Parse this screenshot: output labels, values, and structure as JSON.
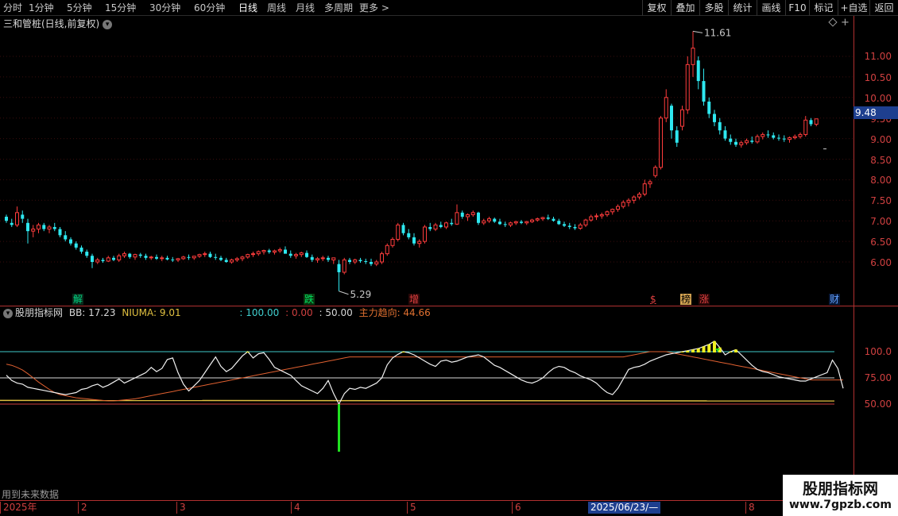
{
  "toolbar": {
    "periods": [
      "分时",
      "1分钟",
      "5分钟",
      "15分钟",
      "30分钟",
      "60分钟",
      "日线",
      "周线",
      "月线",
      "多周期",
      "更多 >"
    ],
    "active_period": "日线",
    "buttons": [
      "复权",
      "叠加",
      "多股",
      "统计",
      "画线",
      "F10",
      "标记",
      "+自选",
      "返回"
    ]
  },
  "chart_title": "三和管桩(日线,前复权)",
  "main_axis": {
    "labels": [
      "11.00",
      "10.50",
      "10.00",
      "9.50",
      "9.00",
      "8.50",
      "8.00",
      "7.50",
      "7.00",
      "6.50",
      "6.00"
    ],
    "current_price": "9.48"
  },
  "annotations": {
    "high": "11.61",
    "low": "5.29"
  },
  "events": [
    {
      "label": "解",
      "color": "#00d080",
      "bg": "#0a2a1a"
    },
    {
      "label": "跌",
      "color": "#00e060",
      "bg": "#0a3a10"
    },
    {
      "label": "增",
      "color": "#e04040",
      "bg": "#2a0808"
    },
    {
      "label": "$",
      "color": "#e04040",
      "bg": "#000000"
    },
    {
      "label": "榜",
      "color": "#000000",
      "bg": "#d0a050"
    },
    {
      "label": "涨",
      "color": "#e04040",
      "bg": "#2a0808"
    },
    {
      "label": "财",
      "color": "#60a0ff",
      "bg": "#0a1a3a"
    }
  ],
  "indicator": {
    "name": "股朋指标网",
    "bb_label": "BB: 17.23",
    "niuma_label": "NIUMA: 9.01",
    "l100": ": 100.00",
    "l0": ": 0.00",
    "l50": ": 50.00",
    "trend_label": "主力趋向: 44.66",
    "axis_labels": [
      "100.0",
      "75.00",
      "50.00"
    ]
  },
  "note": "用到未来数据",
  "dates": [
    "2025年",
    "2",
    "3",
    "4",
    "5",
    "6",
    "2025/06/23/—",
    "8"
  ],
  "watermark": {
    "line1": "股朋指标网",
    "line2": "www.7gpzb.com"
  },
  "colors": {
    "up": "#ff3c3c",
    "down": "#2ee8f0",
    "bg": "#000000"
  },
  "chart_data": {
    "type": "candlestick",
    "candles": [
      [
        7.1,
        7.15,
        6.95,
        7.0
      ],
      [
        6.95,
        7.05,
        6.85,
        6.9
      ],
      [
        6.9,
        7.35,
        6.85,
        7.2
      ],
      [
        7.15,
        7.25,
        6.95,
        7.05
      ],
      [
        6.95,
        7.05,
        6.45,
        6.75
      ],
      [
        6.75,
        6.9,
        6.6,
        6.8
      ],
      [
        6.8,
        6.95,
        6.7,
        6.9
      ],
      [
        6.9,
        6.95,
        6.75,
        6.8
      ],
      [
        6.8,
        6.9,
        6.7,
        6.85
      ],
      [
        6.85,
        6.95,
        6.75,
        6.8
      ],
      [
        6.8,
        6.85,
        6.6,
        6.65
      ],
      [
        6.65,
        6.75,
        6.5,
        6.55
      ],
      [
        6.55,
        6.6,
        6.4,
        6.45
      ],
      [
        6.45,
        6.5,
        6.3,
        6.35
      ],
      [
        6.35,
        6.4,
        6.2,
        6.25
      ],
      [
        6.25,
        6.3,
        6.1,
        6.15
      ],
      [
        6.15,
        6.2,
        5.85,
        6.0
      ],
      [
        6.0,
        6.1,
        5.95,
        6.05
      ],
      [
        6.05,
        6.1,
        5.98,
        6.02
      ],
      [
        6.02,
        6.15,
        6.0,
        6.1
      ],
      [
        6.1,
        6.15,
        6.02,
        6.05
      ],
      [
        6.05,
        6.2,
        6.0,
        6.15
      ],
      [
        6.15,
        6.25,
        6.1,
        6.2
      ],
      [
        6.2,
        6.22,
        6.08,
        6.12
      ],
      [
        6.12,
        6.2,
        6.05,
        6.18
      ],
      [
        6.18,
        6.22,
        6.1,
        6.15
      ],
      [
        6.15,
        6.2,
        6.05,
        6.1
      ],
      [
        6.1,
        6.15,
        6.05,
        6.12
      ],
      [
        6.12,
        6.18,
        6.05,
        6.08
      ],
      [
        6.08,
        6.15,
        6.02,
        6.1
      ],
      [
        6.1,
        6.15,
        6.04,
        6.06
      ],
      [
        6.06,
        6.12,
        6.0,
        6.05
      ],
      [
        6.05,
        6.1,
        6.0,
        6.08
      ],
      [
        6.08,
        6.15,
        6.05,
        6.12
      ],
      [
        6.12,
        6.18,
        6.05,
        6.1
      ],
      [
        6.1,
        6.15,
        6.05,
        6.14
      ],
      [
        6.14,
        6.2,
        6.1,
        6.18
      ],
      [
        6.18,
        6.25,
        6.12,
        6.2
      ],
      [
        6.2,
        6.25,
        6.1,
        6.12
      ],
      [
        6.12,
        6.2,
        6.05,
        6.1
      ],
      [
        6.1,
        6.15,
        6.02,
        6.05
      ],
      [
        6.05,
        6.1,
        5.98,
        6.0
      ],
      [
        6.0,
        6.08,
        5.96,
        6.05
      ],
      [
        6.05,
        6.12,
        6.0,
        6.08
      ],
      [
        6.08,
        6.15,
        6.02,
        6.12
      ],
      [
        6.12,
        6.2,
        6.08,
        6.18
      ],
      [
        6.18,
        6.25,
        6.12,
        6.2
      ],
      [
        6.2,
        6.28,
        6.15,
        6.25
      ],
      [
        6.25,
        6.3,
        6.18,
        6.28
      ],
      [
        6.28,
        6.32,
        6.2,
        6.24
      ],
      [
        6.24,
        6.3,
        6.18,
        6.27
      ],
      [
        6.27,
        6.35,
        6.22,
        6.3
      ],
      [
        6.3,
        6.38,
        6.25,
        6.2
      ],
      [
        6.2,
        6.28,
        6.1,
        6.15
      ],
      [
        6.15,
        6.22,
        6.08,
        6.18
      ],
      [
        6.18,
        6.25,
        6.12,
        6.22
      ],
      [
        6.22,
        6.28,
        6.1,
        6.12
      ],
      [
        6.12,
        6.18,
        6.0,
        6.05
      ],
      [
        6.05,
        6.12,
        5.98,
        6.08
      ],
      [
        6.08,
        6.15,
        6.02,
        6.1
      ],
      [
        6.1,
        6.15,
        6.0,
        6.05
      ],
      [
        6.05,
        6.1,
        5.95,
        6.1
      ],
      [
        5.95,
        6.05,
        5.29,
        5.75
      ],
      [
        5.75,
        6.1,
        5.7,
        6.05
      ],
      [
        6.05,
        6.1,
        5.95,
        6.0
      ],
      [
        6.0,
        6.08,
        5.95,
        6.05
      ],
      [
        6.05,
        6.1,
        5.98,
        6.02
      ],
      [
        6.02,
        6.08,
        5.95,
        6.0
      ],
      [
        6.0,
        6.08,
        5.9,
        5.95
      ],
      [
        5.95,
        6.05,
        5.9,
        6.0
      ],
      [
        6.0,
        6.25,
        5.95,
        6.2
      ],
      [
        6.2,
        6.45,
        6.15,
        6.4
      ],
      [
        6.4,
        6.6,
        6.35,
        6.55
      ],
      [
        6.55,
        6.95,
        6.5,
        6.9
      ],
      [
        6.9,
        6.95,
        6.65,
        6.7
      ],
      [
        6.7,
        6.8,
        6.55,
        6.6
      ],
      [
        6.6,
        6.7,
        6.4,
        6.45
      ],
      [
        6.45,
        6.55,
        6.35,
        6.5
      ],
      [
        6.5,
        6.9,
        6.45,
        6.85
      ],
      [
        6.85,
        6.95,
        6.75,
        6.8
      ],
      [
        6.8,
        6.95,
        6.75,
        6.9
      ],
      [
        6.9,
        6.98,
        6.82,
        6.85
      ],
      [
        6.85,
        6.98,
        6.8,
        6.95
      ],
      [
        6.95,
        7.05,
        6.88,
        6.92
      ],
      [
        6.92,
        7.4,
        6.9,
        7.2
      ],
      [
        7.2,
        7.25,
        7.05,
        7.1
      ],
      [
        7.1,
        7.18,
        7.0,
        7.15
      ],
      [
        7.15,
        7.25,
        7.1,
        7.2
      ],
      [
        7.2,
        7.22,
        6.9,
        6.95
      ],
      [
        6.95,
        7.05,
        6.9,
        7.0
      ],
      [
        7.0,
        7.1,
        6.95,
        7.05
      ],
      [
        7.05,
        7.08,
        6.95,
        6.98
      ],
      [
        6.98,
        7.05,
        6.9,
        6.92
      ],
      [
        6.92,
        6.98,
        6.85,
        6.9
      ],
      [
        6.9,
        6.98,
        6.85,
        6.95
      ],
      [
        6.95,
        7.0,
        6.9,
        6.98
      ],
      [
        6.98,
        7.02,
        6.92,
        6.95
      ],
      [
        6.95,
        7.0,
        6.9,
        6.98
      ],
      [
        6.98,
        7.05,
        6.95,
        7.02
      ],
      [
        7.02,
        7.08,
        6.98,
        7.05
      ],
      [
        7.05,
        7.1,
        7.0,
        7.08
      ],
      [
        7.08,
        7.15,
        7.02,
        7.05
      ],
      [
        7.05,
        7.1,
        6.98,
        7.0
      ],
      [
        7.0,
        7.05,
        6.9,
        6.92
      ],
      [
        6.92,
        6.98,
        6.85,
        6.88
      ],
      [
        6.88,
        6.95,
        6.8,
        6.85
      ],
      [
        6.85,
        6.92,
        6.78,
        6.82
      ],
      [
        6.82,
        6.95,
        6.78,
        6.9
      ],
      [
        6.9,
        7.05,
        6.85,
        7.02
      ],
      [
        7.02,
        7.15,
        6.98,
        7.1
      ],
      [
        7.1,
        7.18,
        7.02,
        7.12
      ],
      [
        7.12,
        7.2,
        7.05,
        7.15
      ],
      [
        7.15,
        7.25,
        7.1,
        7.22
      ],
      [
        7.22,
        7.3,
        7.15,
        7.28
      ],
      [
        7.28,
        7.4,
        7.22,
        7.35
      ],
      [
        7.35,
        7.5,
        7.3,
        7.45
      ],
      [
        7.45,
        7.55,
        7.35,
        7.5
      ],
      [
        7.5,
        7.62,
        7.42,
        7.58
      ],
      [
        7.58,
        7.7,
        7.52,
        7.65
      ],
      [
        7.65,
        8.0,
        7.6,
        7.9
      ],
      [
        7.9,
        8.0,
        7.8,
        7.95
      ],
      [
        8.1,
        8.35,
        8.05,
        8.3
      ],
      [
        8.3,
        9.55,
        8.25,
        9.5
      ],
      [
        9.5,
        10.2,
        9.4,
        10.0
      ],
      [
        9.8,
        9.85,
        9.0,
        9.2
      ],
      [
        9.2,
        9.3,
        8.8,
        8.9
      ],
      [
        9.3,
        9.8,
        9.2,
        9.7
      ],
      [
        9.7,
        11.0,
        9.6,
        10.8
      ],
      [
        10.8,
        11.61,
        10.5,
        11.2
      ],
      [
        10.9,
        11.0,
        10.2,
        10.4
      ],
      [
        10.4,
        10.7,
        9.8,
        9.9
      ],
      [
        9.9,
        10.0,
        9.5,
        9.6
      ],
      [
        9.6,
        9.7,
        9.3,
        9.4
      ],
      [
        9.4,
        9.5,
        9.1,
        9.2
      ],
      [
        9.2,
        9.3,
        8.95,
        9.0
      ],
      [
        9.0,
        9.1,
        8.85,
        8.92
      ],
      [
        8.92,
        9.0,
        8.8,
        8.85
      ],
      [
        8.85,
        8.95,
        8.78,
        8.9
      ],
      [
        8.9,
        9.0,
        8.85,
        8.95
      ],
      [
        8.95,
        9.05,
        8.88,
        8.92
      ],
      [
        8.92,
        9.1,
        8.88,
        9.05
      ],
      [
        9.05,
        9.15,
        8.98,
        9.1
      ],
      [
        9.1,
        9.2,
        9.02,
        9.08
      ],
      [
        9.08,
        9.15,
        8.98,
        9.02
      ],
      [
        9.02,
        9.1,
        8.95,
        9.0
      ],
      [
        9.0,
        9.08,
        8.92,
        8.98
      ],
      [
        8.98,
        9.05,
        8.9,
        9.02
      ],
      [
        9.02,
        9.1,
        8.98,
        9.05
      ],
      [
        9.05,
        9.15,
        9.0,
        9.1
      ],
      [
        9.1,
        9.55,
        9.05,
        9.45
      ],
      [
        9.45,
        9.5,
        9.3,
        9.35
      ],
      [
        9.35,
        9.48,
        9.3,
        9.48
      ]
    ],
    "indicator_series": {
      "white": [
        55,
        45,
        40,
        38,
        32,
        30,
        28,
        26,
        24,
        22,
        20,
        18,
        20,
        22,
        28,
        30,
        35,
        38,
        32,
        36,
        42,
        48,
        40,
        45,
        50,
        55,
        60,
        70,
        62,
        68,
        85,
        88,
        60,
        38,
        25,
        35,
        45,
        60,
        75,
        90,
        72,
        62,
        68,
        80,
        92,
        100,
        88,
        96,
        98,
        85,
        70,
        65,
        60,
        55,
        45,
        35,
        30,
        25,
        20,
        30,
        45,
        20,
        0,
        20,
        30,
        28,
        32,
        30,
        35,
        40,
        50,
        75,
        88,
        95,
        100,
        98,
        94,
        88,
        82,
        76,
        72,
        82,
        84,
        80,
        82,
        86,
        90,
        92,
        94,
        90,
        82,
        74,
        70,
        64,
        58,
        52,
        46,
        42,
        40,
        44,
        50,
        60,
        68,
        72,
        70,
        64,
        60,
        54,
        50,
        46,
        40,
        30,
        22,
        18,
        30,
        48,
        66,
        70,
        72,
        76,
        82,
        86,
        90,
        94,
        96,
        98,
        100,
        102,
        104,
        106,
        110,
        114,
        120,
        108,
        94,
        100,
        104,
        94,
        84,
        74,
        66,
        62,
        60,
        56,
        52,
        50,
        48,
        46,
        44,
        44,
        48,
        52,
        56,
        60,
        84,
        68,
        30
      ],
      "orange": [
        76,
        74,
        70,
        65,
        58,
        50,
        42,
        35,
        28,
        22,
        18,
        16,
        14,
        12,
        11,
        10,
        9,
        8,
        7,
        6,
        6,
        7,
        8,
        9,
        10,
        12,
        14,
        16,
        18,
        20,
        22,
        24,
        26,
        28,
        30,
        32,
        34,
        36,
        38,
        40,
        42,
        44,
        46,
        48,
        50,
        52,
        54,
        56,
        58,
        60,
        62,
        64,
        66,
        68,
        70,
        72,
        74,
        76,
        78,
        80,
        82,
        84,
        86,
        88,
        90,
        90,
        90,
        90,
        90,
        90,
        90,
        90,
        90,
        90,
        90,
        90,
        90,
        90,
        90,
        90,
        90,
        90,
        90,
        90,
        90,
        90,
        90,
        90,
        90,
        90,
        90,
        90,
        90,
        90,
        90,
        90,
        90,
        90,
        90,
        90,
        90,
        90,
        90,
        90,
        90,
        90,
        90,
        90,
        90,
        90,
        90,
        90,
        90,
        90,
        90,
        90,
        92,
        94,
        96,
        98,
        100,
        100,
        100,
        100,
        98,
        96,
        94,
        92,
        90,
        88,
        86,
        84,
        82,
        80,
        78,
        76,
        74,
        72,
        70,
        68,
        66,
        64,
        62,
        60,
        58,
        56,
        54,
        52,
        50,
        48,
        46,
        46,
        46,
        46,
        46,
        46,
        46
      ],
      "yellow_level": 7
    }
  }
}
